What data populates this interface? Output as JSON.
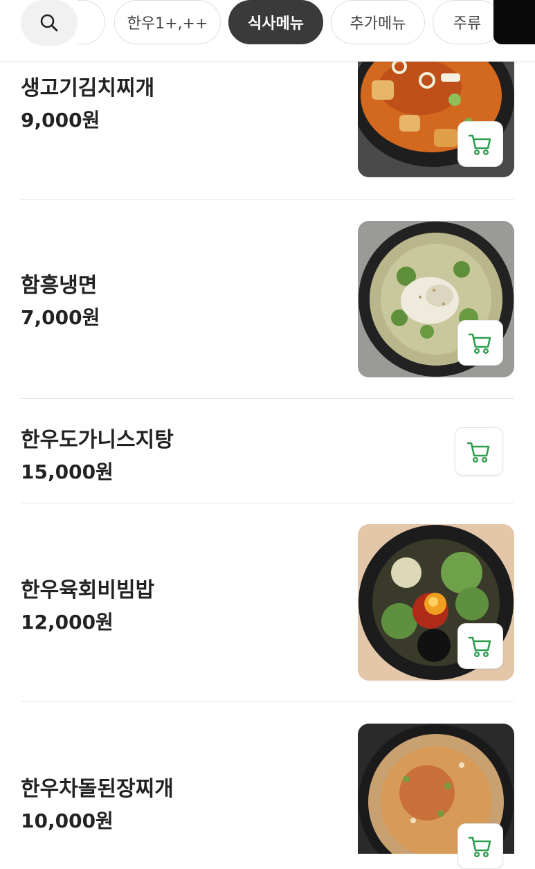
{
  "category_tabs": [
    {
      "label": "한우1+,++",
      "active": false
    },
    {
      "label": "식사메뉴",
      "active": true
    },
    {
      "label": "추가메뉴",
      "active": false
    },
    {
      "label": "주류",
      "active": false
    }
  ],
  "currency_suffix": "원",
  "menu_items": [
    {
      "name": "생고기김치찌개",
      "price": "9,000원",
      "image": "kimchi-stew-photo",
      "has_image": true
    },
    {
      "name": "함흥냉면",
      "price": "7,000원",
      "image": "cold-noodle-photo",
      "has_image": true
    },
    {
      "name": "한우도가니스지탕",
      "price": "15,000원",
      "image": null,
      "has_image": false
    },
    {
      "name": "한우육회비빔밥",
      "price": "12,000원",
      "image": "bibimbap-photo",
      "has_image": true
    },
    {
      "name": "한우차돌된장찌개",
      "price": "10,000원",
      "image": "doenjang-stew-photo",
      "has_image": true
    }
  ],
  "colors": {
    "active_tab_bg": "#3a3a3a",
    "cart_icon": "#2e9e4f",
    "divider": "#e6e6e6"
  },
  "icons": {
    "search": "search-icon",
    "cart": "cart-icon"
  }
}
